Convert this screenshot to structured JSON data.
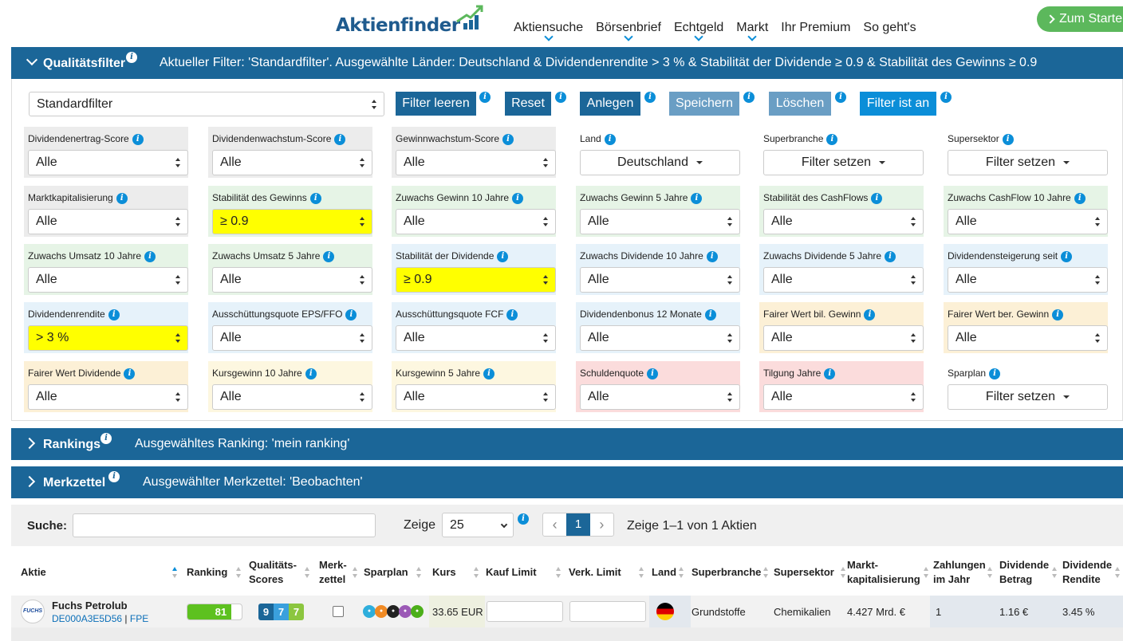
{
  "brand": {
    "name": "Aktienfinder",
    "accent": "#1b6698",
    "info_color": "#0b8ed8",
    "highlight": "#ffff00"
  },
  "nav": {
    "items": [
      "Aktiensuche",
      "Börsenbrief",
      "Echtgeld",
      "Markt",
      "Ihr Premium",
      "So geht's"
    ],
    "cta": "Zum Starte"
  },
  "quality": {
    "title": "Qualitätsfilter",
    "description": "Aktueller Filter: 'Standardfilter'. Ausgewählte Länder: Deutschland & Dividendenrendite > 3 % & Stabilität der Dividende ≥ 0.9 & Stabilität des Gewinns ≥ 0.9",
    "preset": "Standardfilter",
    "buttons": {
      "clear": "Filter leeren",
      "reset": "Reset",
      "create": "Anlegen",
      "save": "Speichern",
      "delete": "Löschen",
      "active": "Filter ist an"
    },
    "cells": [
      {
        "label": "Dividendenertrag-Score",
        "value": "Alle",
        "bg": "#ececec"
      },
      {
        "label": "Dividendenwachstum-Score",
        "value": "Alle",
        "bg": "#ececec"
      },
      {
        "label": "Gewinnwachstum-Score",
        "value": "Alle",
        "bg": "#ececec"
      },
      {
        "label": "Land",
        "value": "Deutschland",
        "bg": "#ffffff"
      },
      {
        "label": "Superbranche",
        "value": "Filter setzen",
        "bg": "#ffffff"
      },
      {
        "label": "Supersektor",
        "value": "Filter setzen",
        "bg": "#ffffff"
      },
      {
        "label": "Marktkapitalisierung",
        "value": "Alle",
        "bg": "#ececec"
      },
      {
        "label": "Stabilität des Gewinns",
        "value": "≥ 0.9",
        "bg": "#e6f4e6"
      },
      {
        "label": "Zuwachs Gewinn 10 Jahre",
        "value": "Alle",
        "bg": "#e6f4e6"
      },
      {
        "label": "Zuwachs Gewinn 5 Jahre",
        "value": "Alle",
        "bg": "#e6f4e6"
      },
      {
        "label": "Stabilität des CashFlows",
        "value": "Alle",
        "bg": "#e6f4e6"
      },
      {
        "label": "Zuwachs CashFlow 10 Jahre",
        "value": "Alle",
        "bg": "#e6f4e6"
      },
      {
        "label": "Zuwachs Umsatz 10 Jahre",
        "value": "Alle",
        "bg": "#e6f4e6"
      },
      {
        "label": "Zuwachs Umsatz 5 Jahre",
        "value": "Alle",
        "bg": "#e6f4e6"
      },
      {
        "label": "Stabilität der Dividende",
        "value": "≥ 0.9",
        "bg": "#e6f2fa"
      },
      {
        "label": "Zuwachs Dividende 10 Jahre",
        "value": "Alle",
        "bg": "#e6f2fa"
      },
      {
        "label": "Zuwachs Dividende 5 Jahre",
        "value": "Alle",
        "bg": "#e6f2fa"
      },
      {
        "label": "Dividendensteigerung seit",
        "value": "Alle",
        "bg": "#e6f2fa"
      },
      {
        "label": "Dividendenrendite",
        "value": "> 3 %",
        "bg": "#e6f2fa"
      },
      {
        "label": "Ausschüttungsquote EPS/FFO",
        "value": "Alle",
        "bg": "#e6f2fa"
      },
      {
        "label": "Ausschüttungsquote FCF",
        "value": "Alle",
        "bg": "#e6f2fa"
      },
      {
        "label": "Dividendenbonus 12 Monate",
        "value": "Alle",
        "bg": "#e6f2fa"
      },
      {
        "label": "Fairer Wert bil. Gewinn",
        "value": "Alle",
        "bg": "#fcf0d6"
      },
      {
        "label": "Fairer Wert ber. Gewinn",
        "value": "Alle",
        "bg": "#fcf0d6"
      },
      {
        "label": "Fairer Wert Dividende",
        "value": "Alle",
        "bg": "#fcf0d6"
      },
      {
        "label": "Kursgewinn 10 Jahre",
        "value": "Alle",
        "bg": "#fdf7e0"
      },
      {
        "label": "Kursgewinn 5 Jahre",
        "value": "Alle",
        "bg": "#fdf7e0"
      },
      {
        "label": "Schuldenquote",
        "value": "Alle",
        "bg": "#fbdcdc"
      },
      {
        "label": "Tilgung Jahre",
        "value": "Alle",
        "bg": "#fbdcdc"
      },
      {
        "label": "Sparplan",
        "value": "Filter setzen",
        "bg": "#ffffff"
      }
    ]
  },
  "rankings": {
    "title": "Rankings",
    "description": "Ausgewähltes Ranking: 'mein ranking'"
  },
  "watchlist": {
    "title": "Merkzettel",
    "description": "Ausgewählter Merkzettel: 'Beobachten'"
  },
  "table": {
    "search_label": "Suche:",
    "search_value": "",
    "show_label": "Zeige",
    "page_size": "25",
    "page": "1",
    "prev": "‹",
    "next": "›",
    "summary": "Zeige 1–1 von 1 Aktien",
    "headers": [
      "Aktie",
      "Ranking",
      "Qualitäts-Scores",
      "Merk-zettel",
      "Sparplan",
      "Kurs",
      "Kauf Limit",
      "Verk. Limit",
      "Land",
      "Superbranche",
      "Supersektor",
      "Markt-kapitalisierung",
      "Zahlungen im Jahr",
      "Dividende Betrag",
      "Dividende Rendite"
    ],
    "row": {
      "logo": "FUCHS",
      "name": "Fuchs Petrolub",
      "isin": "DE000A3E5D56",
      "sep": "|",
      "ticker": "FPE",
      "ranking": "81",
      "ranking_fraction": 0.81,
      "scores": [
        "9",
        "7",
        "7"
      ],
      "score_colors": [
        "#1b6698",
        "#3aa0dd",
        "#8cc63f"
      ],
      "sparplan_icons": [
        "broker-a-icon",
        "broker-b-icon",
        "broker-c-icon",
        "broker-d-icon",
        "broker-e-icon"
      ],
      "price": "33.65 EUR",
      "buy_limit": "",
      "sell_limit": "",
      "country_flag": "germany-flag-icon",
      "superbranche": "Grundstoffe",
      "supersektor": "Chemikalien",
      "market_cap": "4.427 Mrd. €",
      "payments": "1",
      "div_amount": "1.16 €",
      "div_yield": "3.45 %"
    }
  }
}
